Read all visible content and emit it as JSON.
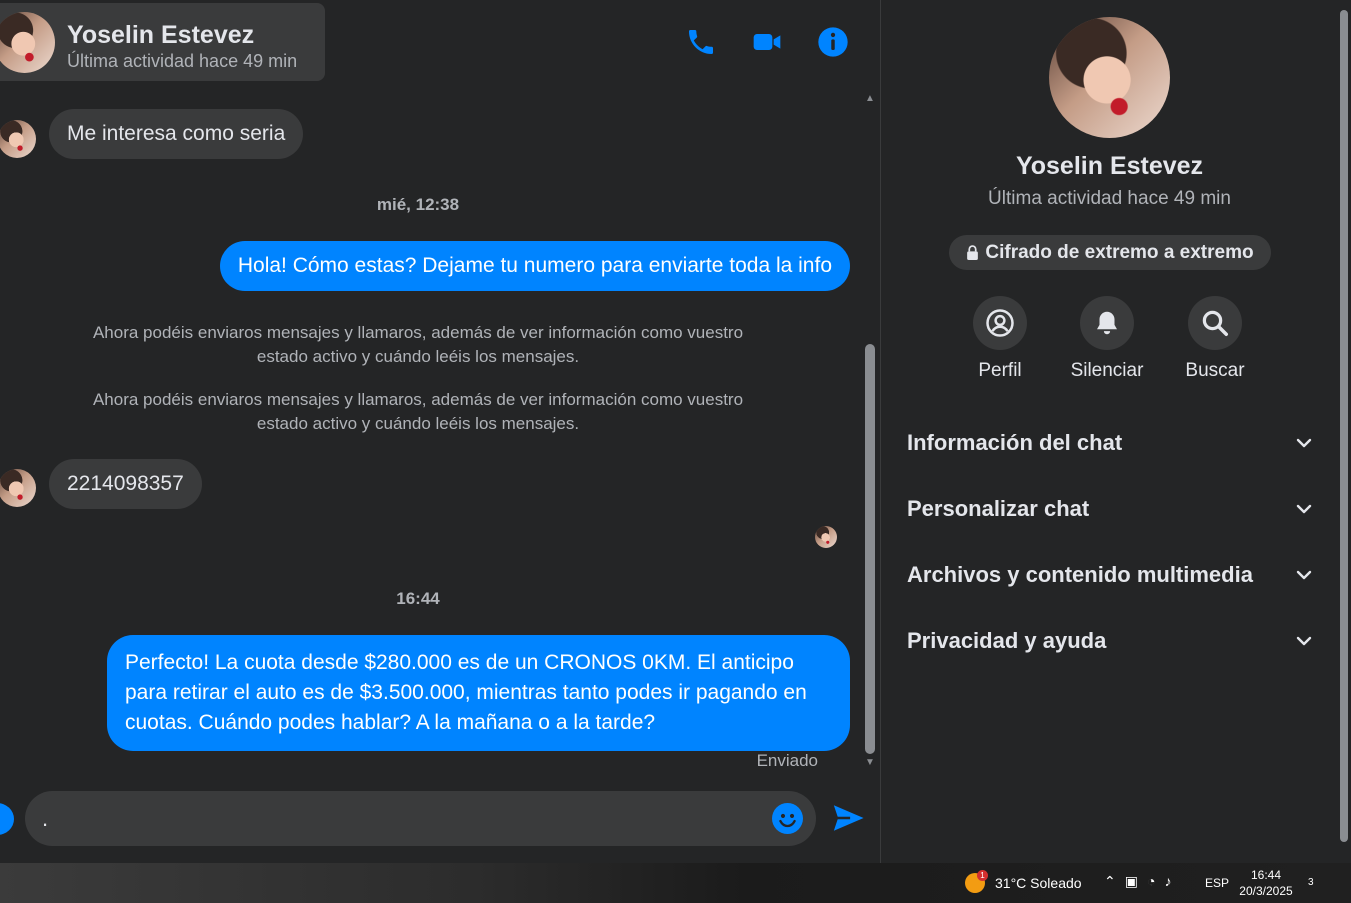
{
  "header": {
    "name": "Yoselin Estevez",
    "status": "Última actividad hace 49 min"
  },
  "messages": {
    "incoming_1": "Me interesa como seria",
    "timestamp_1": "mié, 12:38",
    "outgoing_1": "Hola! Cómo estas? Dejame tu numero para enviarte toda la info",
    "system_note_1": "Ahora podéis enviaros mensajes y llamaros, además de ver información como vuestro estado activo y cuándo leéis los mensajes.",
    "system_note_2": "Ahora podéis enviaros mensajes y llamaros, además de ver información como vuestro estado activo y cuándo leéis los mensajes.",
    "incoming_2": "2214098357",
    "timestamp_2": "16:44",
    "outgoing_2": "Perfecto! La cuota desde $280.000 es de un CRONOS 0KM. El anticipo para retirar el auto es de $3.500.000, mientras tanto podes ir pagando en cuotas. Cuándo podes hablar? A la mañana o a la tarde?",
    "sent_status": "Enviado"
  },
  "composer": {
    "value": "."
  },
  "info_panel": {
    "name": "Yoselin Estevez",
    "status": "Última actividad hace 49 min",
    "encryption_label": "Cifrado de extremo a extremo",
    "actions": [
      {
        "label": "Perfil",
        "icon": "profile-icon"
      },
      {
        "label": "Silenciar",
        "icon": "bell-icon"
      },
      {
        "label": "Buscar",
        "icon": "search-icon"
      }
    ],
    "sections": [
      {
        "label": "Información del chat"
      },
      {
        "label": "Personalizar chat"
      },
      {
        "label": "Archivos y contenido multimedia"
      },
      {
        "label": "Privacidad y ayuda"
      }
    ]
  },
  "taskbar": {
    "weather": "31°C  Soleado",
    "weather_badge": "1",
    "language": "ESP",
    "time": "16:44",
    "date": "20/3/2025",
    "notifications": "3"
  },
  "colors": {
    "accent": "#0084ff",
    "background": "#242526",
    "bubble_in": "#3a3b3c"
  }
}
